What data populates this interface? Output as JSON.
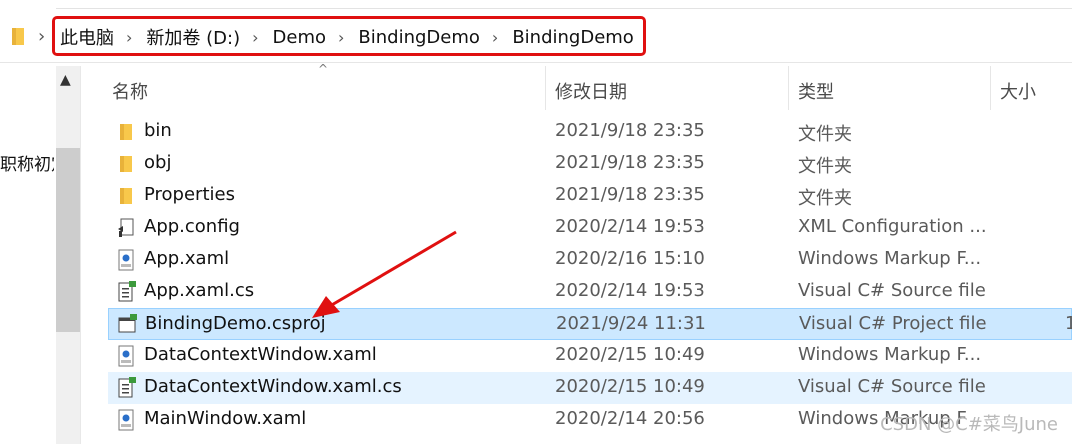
{
  "address_bar": {
    "crumbs": [
      "此电脑",
      "新加卷 (D:)",
      "Demo",
      "BindingDemo",
      "BindingDemo"
    ],
    "separator": "›"
  },
  "left_pane": {
    "text": "职称初定"
  },
  "columns": {
    "name": "名称",
    "date": "修改日期",
    "type": "类型",
    "size": "大小"
  },
  "files": [
    {
      "name": "bin",
      "date": "2021/9/18 23:35",
      "type": "文件夹",
      "icon": "folder-icon"
    },
    {
      "name": "obj",
      "date": "2021/9/18 23:35",
      "type": "文件夹",
      "icon": "folder-icon"
    },
    {
      "name": "Properties",
      "date": "2021/9/18 23:35",
      "type": "文件夹",
      "icon": "folder-icon"
    },
    {
      "name": "App.config",
      "date": "2020/2/14 19:53",
      "type": "XML Configuration ...",
      "icon": "config-file-icon"
    },
    {
      "name": "App.xaml",
      "date": "2020/2/16 15:10",
      "type": "Windows Markup F...",
      "icon": "xaml-file-icon"
    },
    {
      "name": "App.xaml.cs",
      "date": "2020/2/14 19:53",
      "type": "Visual C# Source file",
      "icon": "cs-file-icon"
    },
    {
      "name": "BindingDemo.csproj",
      "date": "2021/9/24 11:31",
      "type": "Visual C# Project file",
      "size": "1",
      "icon": "csproj-file-icon",
      "selected": true
    },
    {
      "name": "DataContextWindow.xaml",
      "date": "2020/2/15 10:49",
      "type": "Windows Markup F...",
      "icon": "xaml-file-icon"
    },
    {
      "name": "DataContextWindow.xaml.cs",
      "date": "2020/2/15 10:49",
      "type": "Visual C# Source file",
      "icon": "cs-file-icon"
    },
    {
      "name": "MainWindow.xaml",
      "date": "2020/2/14 20:56",
      "type": "Windows Markup F",
      "icon": "xaml-file-icon"
    }
  ],
  "watermark": "CSDN @C#菜鸟June",
  "colors": {
    "selection": "#cce8ff",
    "highlight_box": "#e01010",
    "folder": "#f8c84b"
  }
}
